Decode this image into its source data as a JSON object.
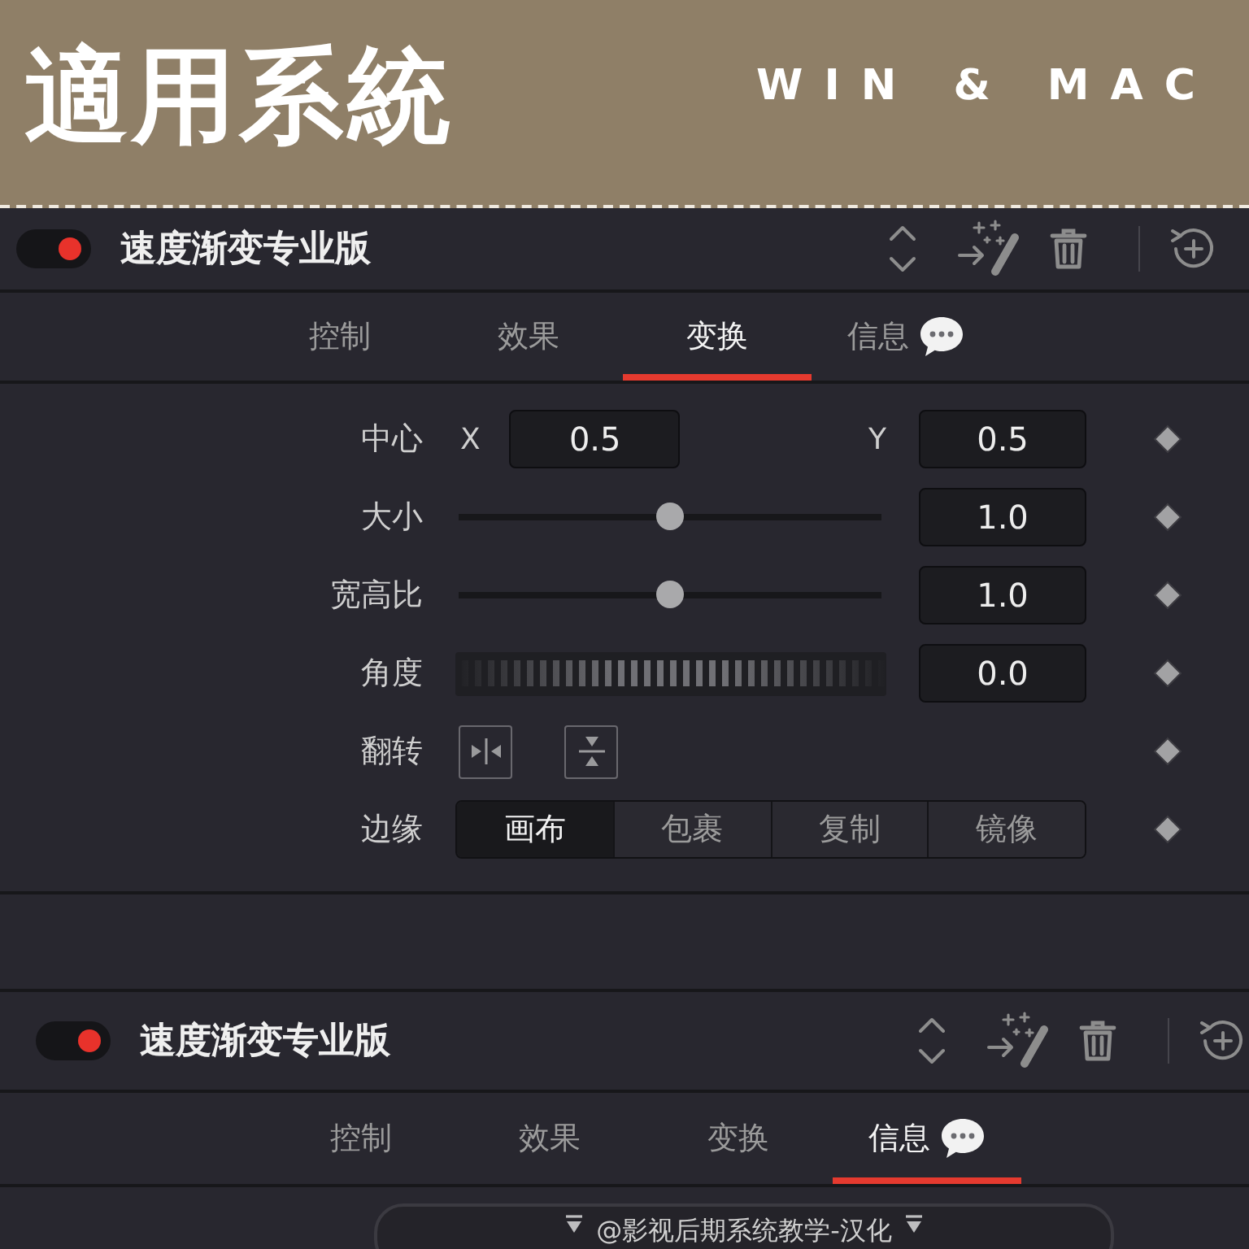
{
  "banner": {
    "title": "適用系統",
    "subtitle": "WIN & MAC"
  },
  "panels": [
    {
      "title": "速度渐变专业版",
      "on": true,
      "tabs": [
        {
          "label": "控制",
          "selected": false,
          "kind": "plain"
        },
        {
          "label": "效果",
          "selected": false,
          "kind": "plain"
        },
        {
          "label": "变换",
          "selected": true,
          "kind": "plain"
        },
        {
          "label": "信息",
          "selected": false,
          "kind": "chat"
        }
      ],
      "controls": [
        {
          "kind": "xy",
          "label": "中心",
          "x_label": "X",
          "x_value": "0.5",
          "y_label": "Y",
          "y_value": "0.5"
        },
        {
          "kind": "slider",
          "label": "大小",
          "level": 0.5,
          "value": "1.0"
        },
        {
          "kind": "slider",
          "label": "宽高比",
          "level": 0.5,
          "value": "1.0"
        },
        {
          "kind": "jog",
          "label": "角度",
          "value": "0.0"
        },
        {
          "kind": "flip",
          "label": "翻转"
        },
        {
          "kind": "segmented",
          "label": "边缘",
          "options": [
            {
              "label": "画布",
              "selected": true
            },
            {
              "label": "包裹",
              "selected": false
            },
            {
              "label": "复制",
              "selected": false
            },
            {
              "label": "镜像",
              "selected": false
            }
          ]
        }
      ]
    },
    {
      "title": "速度渐变专业版",
      "on": true,
      "tabs": [
        {
          "label": "控制",
          "selected": false,
          "kind": "plain"
        },
        {
          "label": "效果",
          "selected": false,
          "kind": "plain"
        },
        {
          "label": "变换",
          "selected": false,
          "kind": "plain"
        },
        {
          "label": "信息",
          "selected": true,
          "kind": "chat"
        }
      ],
      "dropdown": {
        "value": "@影视后期系统教学-汉化"
      }
    }
  ]
}
